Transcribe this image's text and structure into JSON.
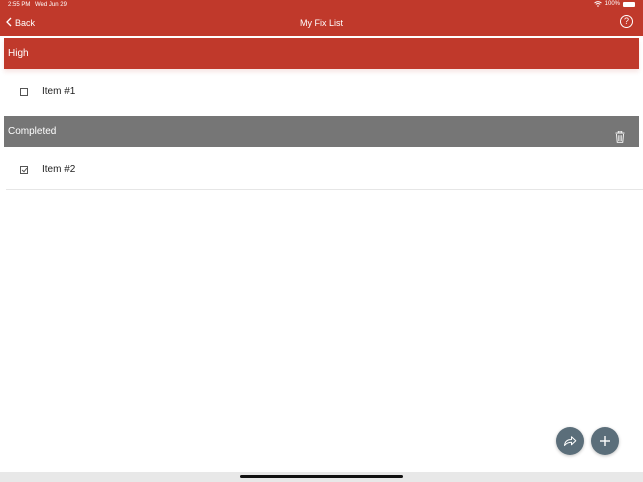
{
  "status_bar": {
    "time": "2:55 PM",
    "date": "Wed Jun 29",
    "battery": "100%"
  },
  "nav": {
    "back_label": "Back",
    "title": "My Fix List",
    "help_label": "?"
  },
  "sections": [
    {
      "title": "High",
      "color": "#c0392b",
      "items": [
        {
          "label": "Item #1",
          "checked": false
        }
      ]
    },
    {
      "title": "Completed",
      "color": "#767676",
      "items": [
        {
          "label": "Item #2",
          "checked": true
        }
      ]
    }
  ],
  "colors": {
    "accent": "#c0392b",
    "completed": "#767676",
    "fab": "#5b6e7a"
  },
  "icons": {
    "back": "chevron-left-icon",
    "help": "question-circle-icon",
    "trash": "trash-icon",
    "share": "share-arrow-icon",
    "add": "plus-icon"
  }
}
